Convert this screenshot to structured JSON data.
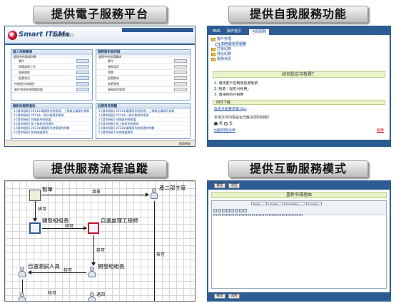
{
  "panels": {
    "p1": {
      "title": "提供電子服務平台",
      "logo": "Smart ITSMs",
      "subtitle": "電子服務窗口",
      "left_box_title": "個人待辦事項",
      "left_box_header": "處理中的事項計數",
      "left_rows": [
        "事件",
        "問題處理工作",
        "變更處理",
        "配置項目",
        "待處理交辦處理",
        "事件管理系統問題追蹤"
      ],
      "right_box_title": "服務提供者待辦",
      "right_box_header": "處理中的申請事項",
      "right_rows": [
        "事件",
        "服務請求",
        "問題",
        "配置需求",
        "變更管理",
        "服務級別管理"
      ],
      "left_list_title": "最新的服務通知",
      "left_links": [
        "1.[請求服務] 2011年電腦版系統管理，上傳報告檔案的通報",
        "2.[請求服務] 2011年一般作業請求處理",
        "3.[請求服務] 伺服器系統維護",
        "4.[請求服務] 線上報表系統通知",
        "5.[請求服務] 2011年電腦版系統管理的問題",
        "6.[請求服務] 系統維護通知"
      ],
      "right_list_title": "近期常見問題",
      "right_links": [
        "1.[請求服務] 2011年電腦版系統管理，上傳報告檔案的通報",
        "2.[請求服務] 2011年一般作業請求處理",
        "3.[請求服務] 伺服器系統維護",
        "4.[請求服務] 線上報表系統通知",
        "5.[請求服務] 2011年電腦版系統管理的問題",
        "6.[請求服務] 系統維護通知"
      ],
      "status": "網際網路"
    },
    "p2": {
      "title": "提供自我服務功能",
      "tab_bms": "BMS",
      "tab_guide": "操作指引",
      "tab_qa": "自助服務",
      "tree": [
        "客戶管理",
        "如何設定月租費",
        "訂單紀錄",
        "通話紀錄",
        "帳務資訊"
      ],
      "question": "如何設定月租費？",
      "steps": [
        "1. 選擇客戶名稱後點選帳號",
        "2. 點選「設定月租費」",
        "3. 選擇新的月租費"
      ],
      "attach": "附件下載",
      "attach_link": "設定月租費步驟.doc",
      "ask": "本項文件內容是否已解決您的問題？",
      "yes": "是",
      "no": "否",
      "back": "回顧問題清單",
      "close": "結束"
    },
    "p3": {
      "title": "提供服務流程追蹤",
      "nodes": [
        "製單",
        "產二部主管",
        "開發組組長",
        "自選處理工程師",
        "開發組組長",
        "自選測試人員"
      ],
      "edges": [
        "填單",
        "核可",
        "核可",
        "核可",
        "核可",
        "核可",
        "退回"
      ]
    },
    "p4": {
      "title": "提供互動服務模式",
      "btn_ok": "確認",
      "btn_back": "返回",
      "form_title": "重新申請理由",
      "sel_style": "- Styles -",
      "sel_format": "- Format -",
      "sel_font": "- Font family -",
      "sel_size": "- Font size -"
    }
  }
}
